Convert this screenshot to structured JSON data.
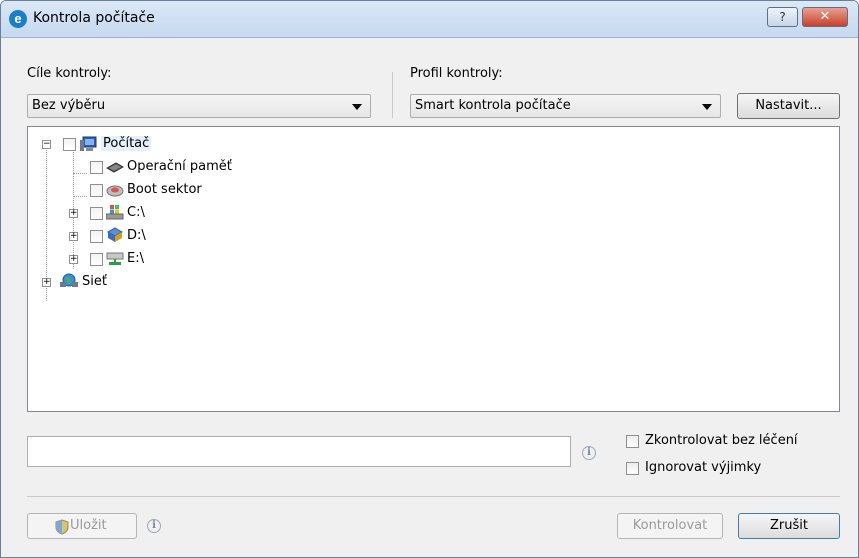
{
  "window": {
    "title": "Kontrola počítače",
    "app_icon_letter": "e",
    "help_label": "?",
    "close_label": "✕"
  },
  "targets": {
    "label": "Cíle kontroly:",
    "selected": "Bez výběru"
  },
  "profile": {
    "label": "Profil kontroly:",
    "selected": "Smart kontrola počítače",
    "setup_button": "Nastavit..."
  },
  "tree": {
    "items": [
      {
        "label": "Počítač",
        "icon": "computer-icon",
        "expanded": true,
        "checked": false
      },
      {
        "label": "Operační paměť",
        "icon": "memory-chip-icon",
        "checked": false
      },
      {
        "label": "Boot sektor",
        "icon": "disk-drive-icon",
        "checked": false
      },
      {
        "label": "C:\\",
        "icon": "windows-drive-icon",
        "expanded": false,
        "checked": false
      },
      {
        "label": "D:\\",
        "icon": "optical-drive-icon",
        "expanded": false,
        "checked": false
      },
      {
        "label": "E:\\",
        "icon": "network-drive-icon",
        "expanded": false,
        "checked": false
      },
      {
        "label": "Sieť",
        "icon": "network-globe-icon",
        "expanded": false
      }
    ]
  },
  "path_field": {
    "value": ""
  },
  "options": {
    "no_clean_label": "Zkontrolovat bez léčení",
    "ignore_exclusions_label": "Ignorovat výjimky"
  },
  "footer": {
    "save_button": "Uložit",
    "scan_button": "Kontrolovat",
    "cancel_button": "Zrušit"
  },
  "icons": {
    "info": "i"
  }
}
